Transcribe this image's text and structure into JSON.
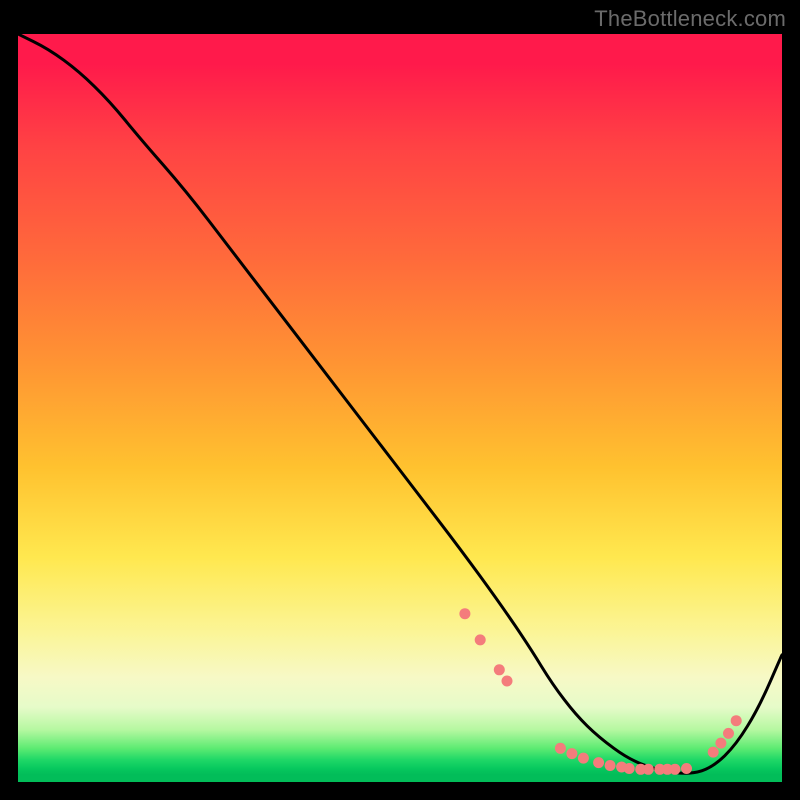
{
  "watermark": "TheBottleneck.com",
  "colors": {
    "background": "#000000",
    "curve": "#000000",
    "markers": "#f47c7c",
    "gradient_top": "#ff1a4b",
    "gradient_mid": "#ffe84f",
    "gradient_bottom": "#02bd59"
  },
  "chart_data": {
    "type": "line",
    "title": "",
    "xlabel": "",
    "ylabel": "",
    "xlim": [
      0,
      100
    ],
    "ylim": [
      0,
      100
    ],
    "series": [
      {
        "name": "curve",
        "x": [
          0,
          4,
          8,
          12,
          16,
          22,
          28,
          34,
          40,
          46,
          52,
          58,
          63,
          67,
          70,
          73,
          76,
          80,
          84,
          88,
          91,
          94,
          97,
          100
        ],
        "values": [
          100,
          98,
          95,
          91,
          86,
          79,
          71,
          63,
          55,
          47,
          39,
          31,
          24,
          18,
          13,
          9,
          6,
          3,
          1.5,
          1,
          2,
          5,
          10,
          17
        ]
      }
    ],
    "markers": [
      {
        "x": 58.5,
        "y": 22.5
      },
      {
        "x": 60.5,
        "y": 19.0
      },
      {
        "x": 63.0,
        "y": 15.0
      },
      {
        "x": 64.0,
        "y": 13.5
      },
      {
        "x": 71.0,
        "y": 4.5
      },
      {
        "x": 72.5,
        "y": 3.8
      },
      {
        "x": 74.0,
        "y": 3.2
      },
      {
        "x": 76.0,
        "y": 2.6
      },
      {
        "x": 77.5,
        "y": 2.2
      },
      {
        "x": 79.0,
        "y": 2.0
      },
      {
        "x": 80.0,
        "y": 1.8
      },
      {
        "x": 81.5,
        "y": 1.7
      },
      {
        "x": 82.5,
        "y": 1.7
      },
      {
        "x": 84.0,
        "y": 1.7
      },
      {
        "x": 85.0,
        "y": 1.7
      },
      {
        "x": 86.0,
        "y": 1.7
      },
      {
        "x": 87.5,
        "y": 1.8
      },
      {
        "x": 91.0,
        "y": 4.0
      },
      {
        "x": 92.0,
        "y": 5.2
      },
      {
        "x": 93.0,
        "y": 6.5
      },
      {
        "x": 94.0,
        "y": 8.2
      }
    ]
  }
}
